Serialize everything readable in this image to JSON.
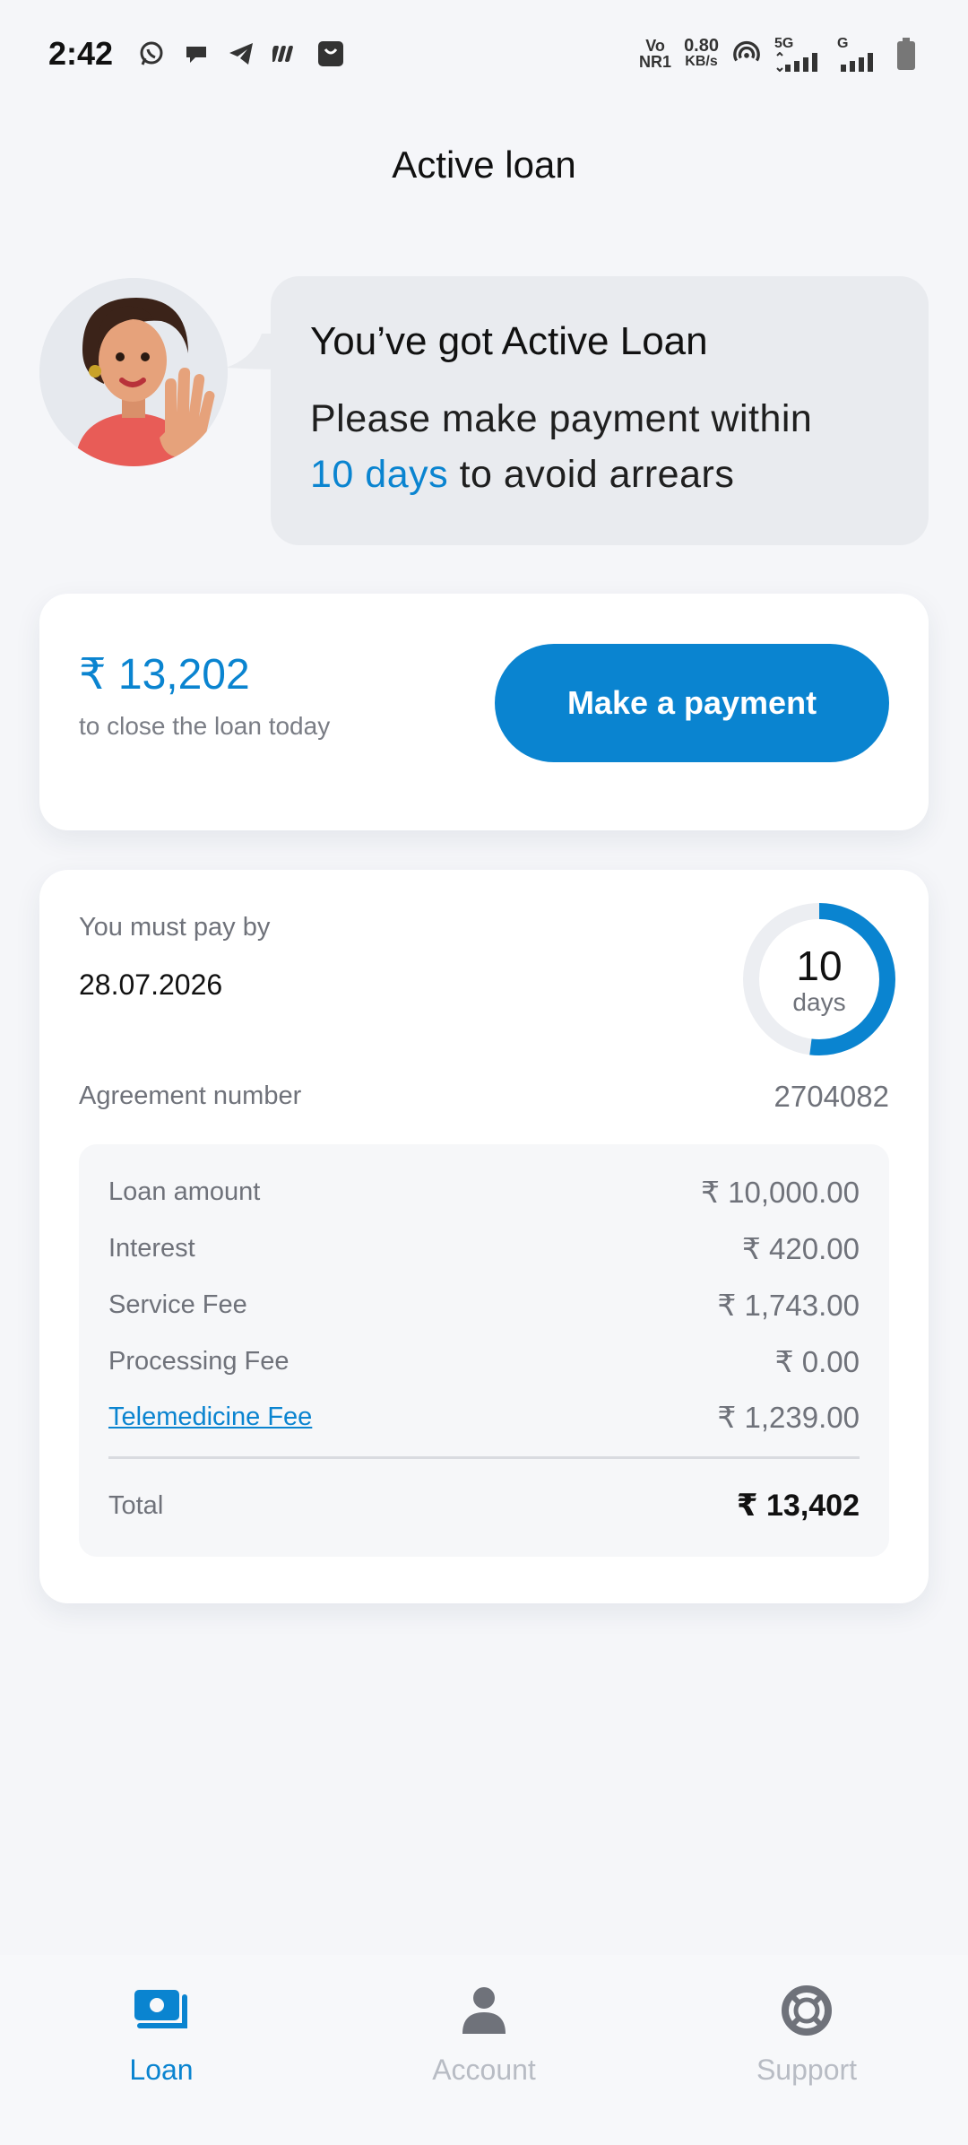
{
  "status_bar": {
    "time": "2:42",
    "net_label_top": "Vo",
    "net_label_bottom": "NR1",
    "speed_value": "0.80",
    "speed_unit": "KB/s",
    "network_5g": "5G",
    "network_g": "G"
  },
  "header": {
    "title": "Active loan"
  },
  "greeting": {
    "title": "You’ve got Active Loan",
    "text_part1": "Please make payment within",
    "days_highlight": "10 days",
    "text_part2": "to avoid arrears"
  },
  "payment_card": {
    "amount": "₹ 13,202",
    "subtitle": "to close the loan today",
    "button_label": "Make a payment"
  },
  "details": {
    "due_label": "You must pay by",
    "due_date": "28.07.2026",
    "days_left": "10",
    "days_unit": "days",
    "days_progress_fraction": 0.52,
    "agreement_label": "Agreement number",
    "agreement_number": "2704082",
    "rows": [
      {
        "label": "Loan amount",
        "value": "₹ 10,000.00"
      },
      {
        "label": "Interest",
        "value": "₹ 420.00"
      },
      {
        "label": "Service Fee",
        "value": "₹ 1,743.00"
      },
      {
        "label": "Processing Fee",
        "value": "₹ 0.00"
      },
      {
        "label": "Telemedicine Fee",
        "value": "₹ 1,239.00"
      }
    ],
    "total_label": "Total",
    "total_value": "₹ 13,402"
  },
  "bottom_nav": {
    "items": [
      {
        "label": "Loan",
        "icon": "loan-icon",
        "active": true
      },
      {
        "label": "Account",
        "icon": "account-icon",
        "active": false
      },
      {
        "label": "Support",
        "icon": "support-icon",
        "active": false
      }
    ]
  },
  "colors": {
    "accent": "#0a84d0",
    "background": "#f5f6f9",
    "muted_text": "#6f727a",
    "inactive_nav": "#b8bcc4"
  }
}
